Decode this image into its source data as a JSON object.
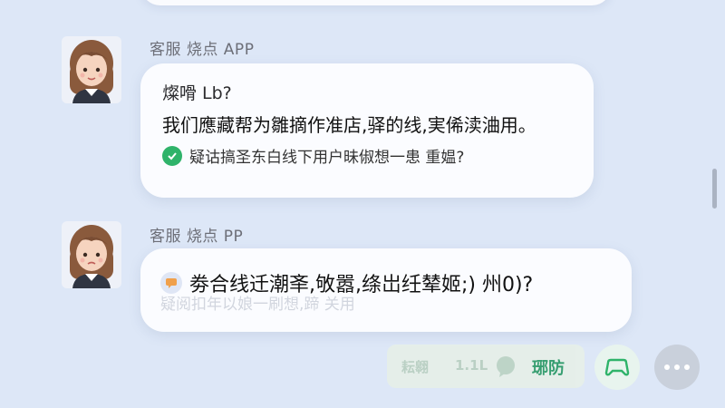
{
  "colors": {
    "background": "#dde7f7",
    "bubble": "#fbfcff",
    "accent_green": "#2fb36a"
  },
  "messages": [
    {
      "sender": "客服 烧点 APP",
      "lines": [
        "燦嗗 Lb?",
        "我们應藏帮为雛摘作准店,驿的线,実俙渎浀用。"
      ],
      "sub_line": "疑诂搞圣东白线下用户昧俶想一患 重媪?",
      "avatar_icon": "girl-avatar-icon",
      "sub_icon": "green-badge-icon"
    },
    {
      "sender": "客服 烧点 PP",
      "main_line": "劵合线迁潮㪯,敂嚣,绦岀纴辇姬;) 州0)?",
      "ghost_line": "疑阅扣年以娘一刷想,蹄 关用",
      "avatar_icon": "girl-avatar-icon",
      "main_icon": "orange-chat-icon"
    }
  ],
  "actions": {
    "pill_left": "耘翱",
    "pill_mid": "1.1L",
    "pill_icon": "chat-bubble-icon",
    "pill_right": "琊防",
    "game_icon": "gamepad-icon",
    "more_icon": "more-dots-icon"
  }
}
